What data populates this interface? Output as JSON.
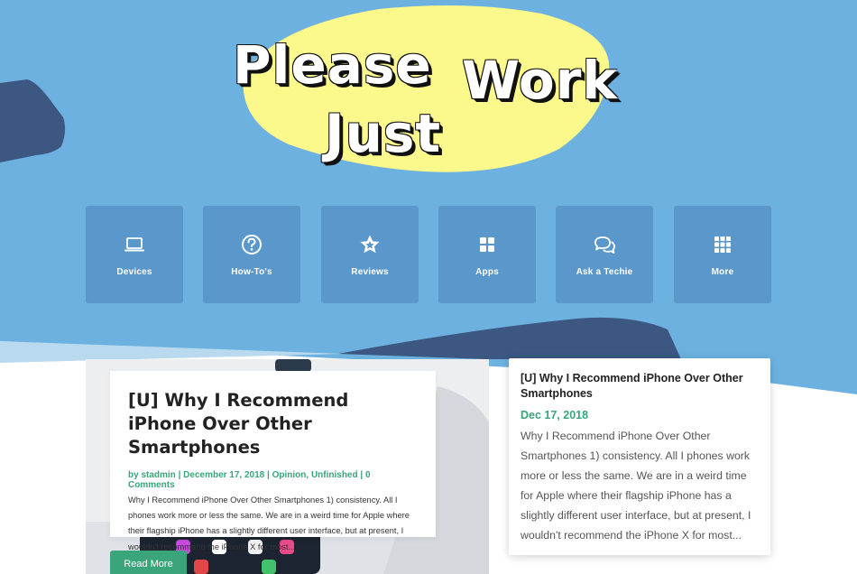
{
  "logo": {
    "word1": "Please",
    "word2": "Work",
    "word3": "Just"
  },
  "categories": [
    {
      "label": "Devices",
      "icon": "laptop-icon"
    },
    {
      "label": "How-To's",
      "icon": "question-circle-icon"
    },
    {
      "label": "Reviews",
      "icon": "star-icon"
    },
    {
      "label": "Apps",
      "icon": "apps-grid-icon"
    },
    {
      "label": "Ask a Techie",
      "icon": "chat-bubbles-icon"
    },
    {
      "label": "More",
      "icon": "more-grid-icon"
    }
  ],
  "featured": {
    "title": "[U] Why I Recommend iPhone Over Other Smartphones",
    "meta": {
      "by": "by ",
      "author": "stadmin",
      "sep": " | ",
      "date": "December 17, 2018",
      "cat1": "Opinion",
      "comma": ", ",
      "cat2": "Unfinished",
      "comments": "0 Comments"
    },
    "excerpt": "Why I Recommend iPhone Over Other Smartphones 1) consistency. All I phones work more or less the same. We are in a weird time for Apple where their flagship iPhone has a slightly different user interface, but at present, I wouldn't recommend the iPhone X for most...",
    "button": "Read More"
  },
  "sidebar_post": {
    "title": "[U] Why I Recommend iPhone Over Other Smartphones",
    "date": "Dec 17, 2018",
    "excerpt": "Why I Recommend iPhone Over Other Smartphones 1) consistency. All I phones work more or less the same. We are in a weird time for Apple where their flagship iPhone has a slightly different user interface, but at present, I wouldn't recommend the iPhone X for most..."
  },
  "colors": {
    "sky": "#6cb1df",
    "tile": "#5a98cc",
    "navy": "#3b5782",
    "yellow": "#fbf98c",
    "green": "#3aa57a"
  }
}
